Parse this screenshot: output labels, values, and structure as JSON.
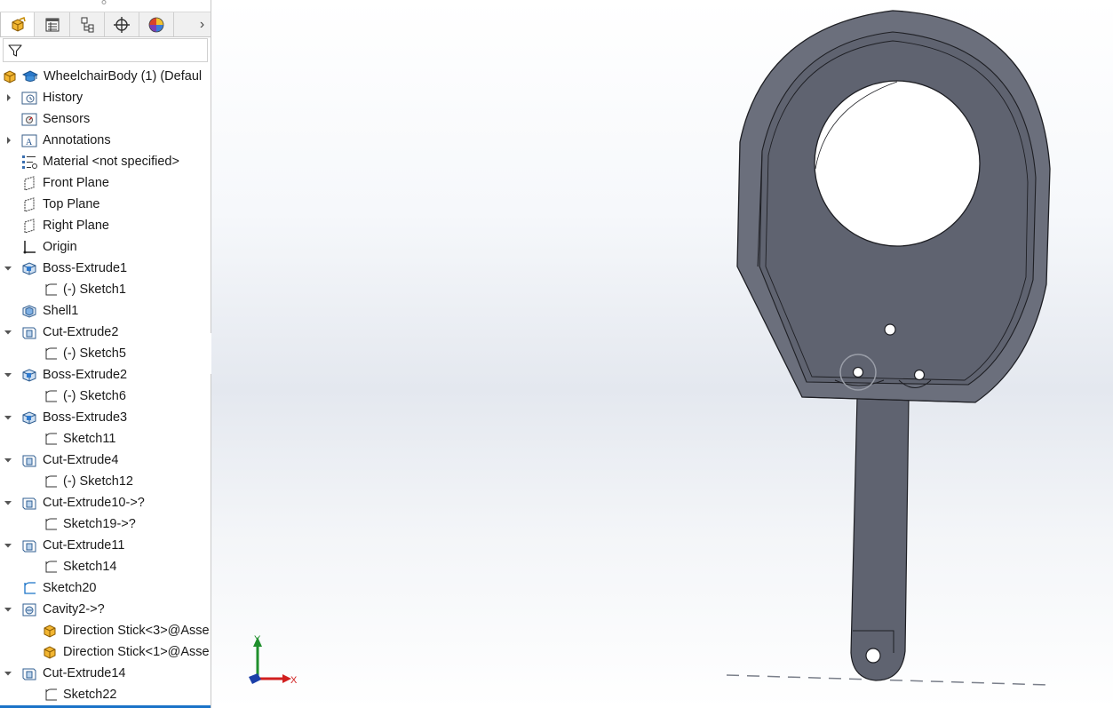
{
  "tabs": [
    {
      "name": "featuremanager-tab",
      "icon": "part-icon",
      "active": true
    },
    {
      "name": "propertymanager-tab",
      "icon": "property-list-icon",
      "active": false
    },
    {
      "name": "configurationmanager-tab",
      "icon": "configuration-icon",
      "active": false
    },
    {
      "name": "dimxpert-tab",
      "icon": "crosshair-icon",
      "active": false
    },
    {
      "name": "display-manager-tab",
      "icon": "appearance-ball-icon",
      "active": false
    }
  ],
  "tree": {
    "root_label": "WheelchairBody (1)  (Defaul",
    "items": [
      {
        "label": "History",
        "icon": "history-folder-icon",
        "indent": 0,
        "expander": "collapsed"
      },
      {
        "label": "Sensors",
        "icon": "sensors-folder-icon",
        "indent": 0,
        "expander": "none"
      },
      {
        "label": "Annotations",
        "icon": "annotations-folder-icon",
        "indent": 0,
        "expander": "collapsed"
      },
      {
        "label": "Material <not specified>",
        "icon": "material-icon",
        "indent": 0,
        "expander": "none"
      },
      {
        "label": "Front Plane",
        "icon": "plane-icon",
        "indent": 0,
        "expander": "none"
      },
      {
        "label": "Top Plane",
        "icon": "plane-icon",
        "indent": 0,
        "expander": "none"
      },
      {
        "label": "Right Plane",
        "icon": "plane-icon",
        "indent": 0,
        "expander": "none"
      },
      {
        "label": "Origin",
        "icon": "origin-icon",
        "indent": 0,
        "expander": "none"
      },
      {
        "label": "Boss-Extrude1",
        "icon": "boss-extrude-icon",
        "indent": 0,
        "expander": "expanded"
      },
      {
        "label": "(-) Sketch1",
        "icon": "sketch-icon",
        "indent": 1,
        "expander": "none"
      },
      {
        "label": "Shell1",
        "icon": "shell-icon",
        "indent": 0,
        "expander": "none"
      },
      {
        "label": "Cut-Extrude2",
        "icon": "cut-extrude-icon",
        "indent": 0,
        "expander": "expanded"
      },
      {
        "label": "(-) Sketch5",
        "icon": "sketch-icon",
        "indent": 1,
        "expander": "none"
      },
      {
        "label": "Boss-Extrude2",
        "icon": "boss-extrude-icon",
        "indent": 0,
        "expander": "expanded"
      },
      {
        "label": "(-) Sketch6",
        "icon": "sketch-icon",
        "indent": 1,
        "expander": "none"
      },
      {
        "label": "Boss-Extrude3",
        "icon": "boss-extrude-icon",
        "indent": 0,
        "expander": "expanded"
      },
      {
        "label": "Sketch11",
        "icon": "sketch-icon",
        "indent": 1,
        "expander": "none"
      },
      {
        "label": "Cut-Extrude4",
        "icon": "cut-extrude-icon",
        "indent": 0,
        "expander": "expanded"
      },
      {
        "label": "(-) Sketch12",
        "icon": "sketch-icon",
        "indent": 1,
        "expander": "none"
      },
      {
        "label": "Cut-Extrude10->?",
        "icon": "cut-extrude-icon",
        "indent": 0,
        "expander": "expanded"
      },
      {
        "label": "Sketch19->?",
        "icon": "sketch-icon",
        "indent": 1,
        "expander": "none"
      },
      {
        "label": "Cut-Extrude11",
        "icon": "cut-extrude-icon",
        "indent": 0,
        "expander": "expanded"
      },
      {
        "label": "Sketch14",
        "icon": "sketch-icon",
        "indent": 1,
        "expander": "none"
      },
      {
        "label": "Sketch20",
        "icon": "sketch-blue-icon",
        "indent": 0,
        "expander": "none"
      },
      {
        "label": "Cavity2->?",
        "icon": "cavity-icon",
        "indent": 0,
        "expander": "expanded"
      },
      {
        "label": "Direction Stick<3>@Asse",
        "icon": "part-icon",
        "indent": 1,
        "expander": "none"
      },
      {
        "label": "Direction Stick<1>@Asse",
        "icon": "part-icon",
        "indent": 1,
        "expander": "none"
      },
      {
        "label": "Cut-Extrude14",
        "icon": "cut-extrude-icon",
        "indent": 0,
        "expander": "expanded"
      },
      {
        "label": "Sketch22",
        "icon": "sketch-icon",
        "indent": 1,
        "expander": "none"
      }
    ]
  },
  "triad": {
    "y_label": "Y",
    "x_label": "X"
  },
  "colors": {
    "model_face": "#5f6370",
    "model_edge": "#1e1f24",
    "model_rim": "#6b6f7c",
    "accent_blue": "#1a73c8",
    "axis_green": "#1f8f2c",
    "axis_red": "#d11f1f"
  }
}
